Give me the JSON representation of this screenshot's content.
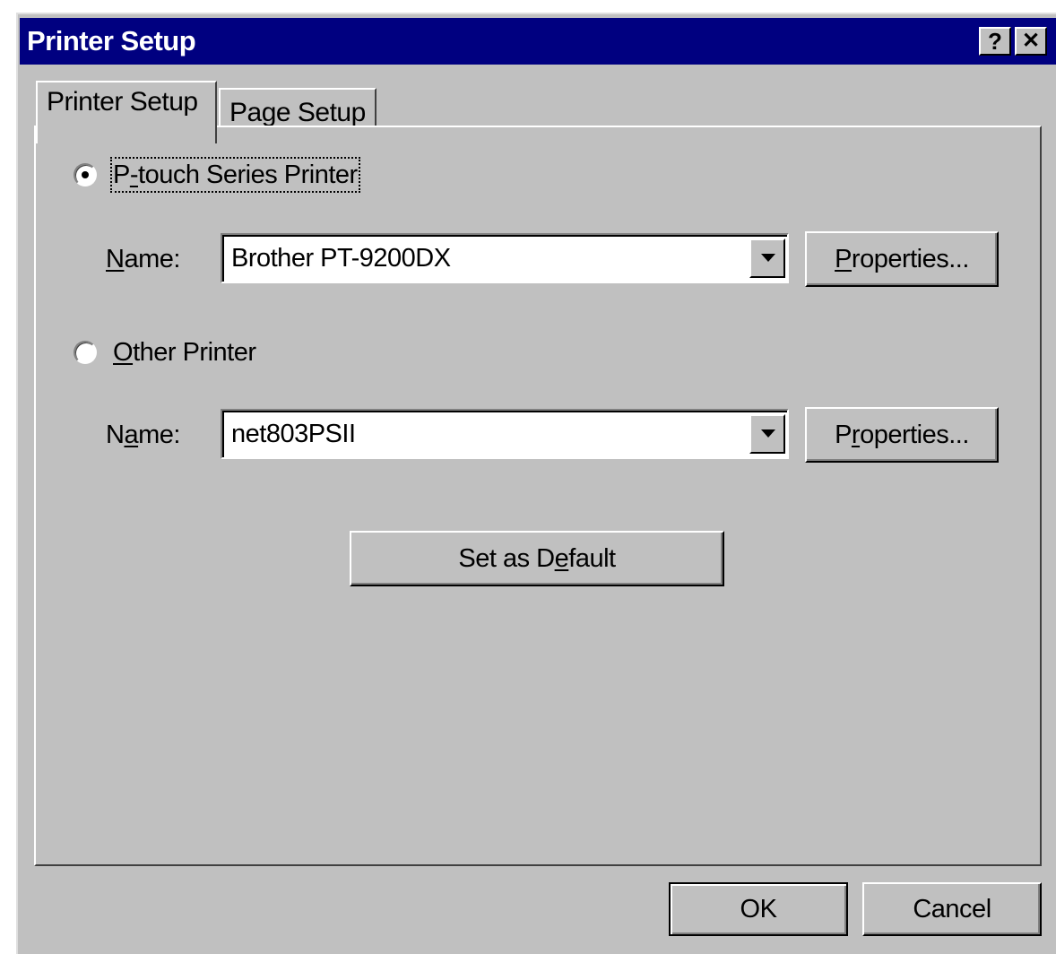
{
  "window": {
    "title": "Printer Setup",
    "help_glyph": "?",
    "close_glyph": "✕"
  },
  "tabs": [
    {
      "label": "Printer Setup",
      "active": true
    },
    {
      "label": "Page Setup",
      "active": false
    }
  ],
  "ptouch_option": {
    "label_pre": "P",
    "label_mnemonic": "-",
    "label_post": "touch Series Printer",
    "selected": true,
    "name_label_mnemonic": "N",
    "name_label_post": "ame:",
    "printer_name": "Brother PT-9200DX",
    "properties_mnemonic": "P",
    "properties_post": "roperties..."
  },
  "other_option": {
    "label_mnemonic": "O",
    "label_post": "ther Printer",
    "selected": false,
    "name_label_pre": "N",
    "name_label_mnemonic": "a",
    "name_label_post": "me:",
    "printer_name": "net803PSII",
    "properties_pre": "P",
    "properties_mnemonic": "r",
    "properties_post": "operties..."
  },
  "set_default": {
    "pre": "Set as D",
    "mnemonic": "e",
    "post": "fault"
  },
  "footer": {
    "ok_label": "OK",
    "cancel_label": "Cancel"
  },
  "icons": {
    "dropdown": "chevron-down-icon",
    "help": "help-icon",
    "close": "close-icon"
  }
}
